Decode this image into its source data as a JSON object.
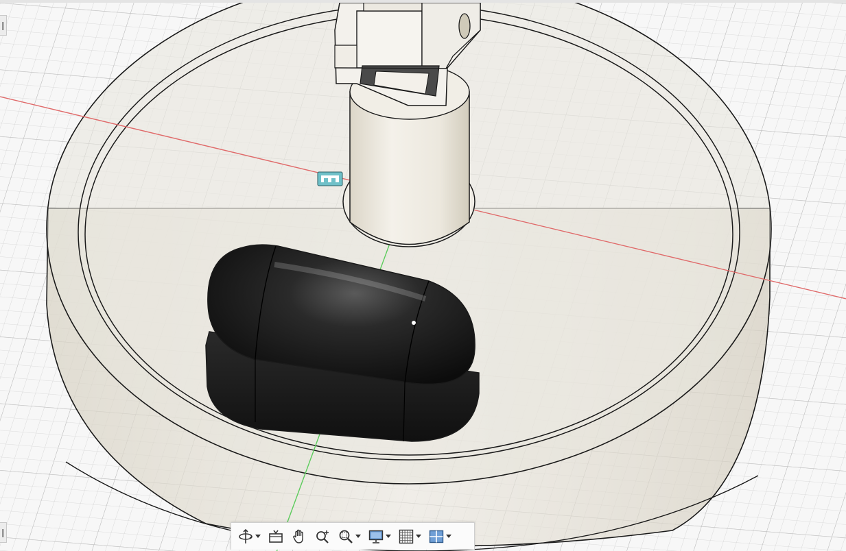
{
  "viewport": {
    "background": "#f7f7f7",
    "grid_color": "#c8c8c8",
    "axis_colors": {
      "x": "#e06a6a",
      "y": "#5ccc5c"
    },
    "body_color": "#e8e4da",
    "keycap_color": "#151515"
  },
  "edge_handles": [
    {
      "name": "left-panel-handle-top"
    },
    {
      "name": "left-panel-handle-bottom"
    }
  ],
  "toolbar": {
    "tools": [
      {
        "id": "orbit",
        "icon": "orbit-icon",
        "has_dropdown": true
      },
      {
        "id": "look-at",
        "icon": "look-at-icon",
        "has_dropdown": false
      },
      {
        "id": "pan",
        "icon": "pan-hand-icon",
        "has_dropdown": false
      },
      {
        "id": "zoom",
        "icon": "zoom-icon",
        "has_dropdown": false
      },
      {
        "id": "fit",
        "icon": "zoom-window-icon",
        "has_dropdown": true
      },
      {
        "id": "display-settings",
        "icon": "display-monitor-icon",
        "has_dropdown": true
      },
      {
        "id": "grid-settings",
        "icon": "grid-icon",
        "has_dropdown": true
      },
      {
        "id": "viewports",
        "icon": "viewports-icon",
        "has_dropdown": true
      }
    ]
  }
}
